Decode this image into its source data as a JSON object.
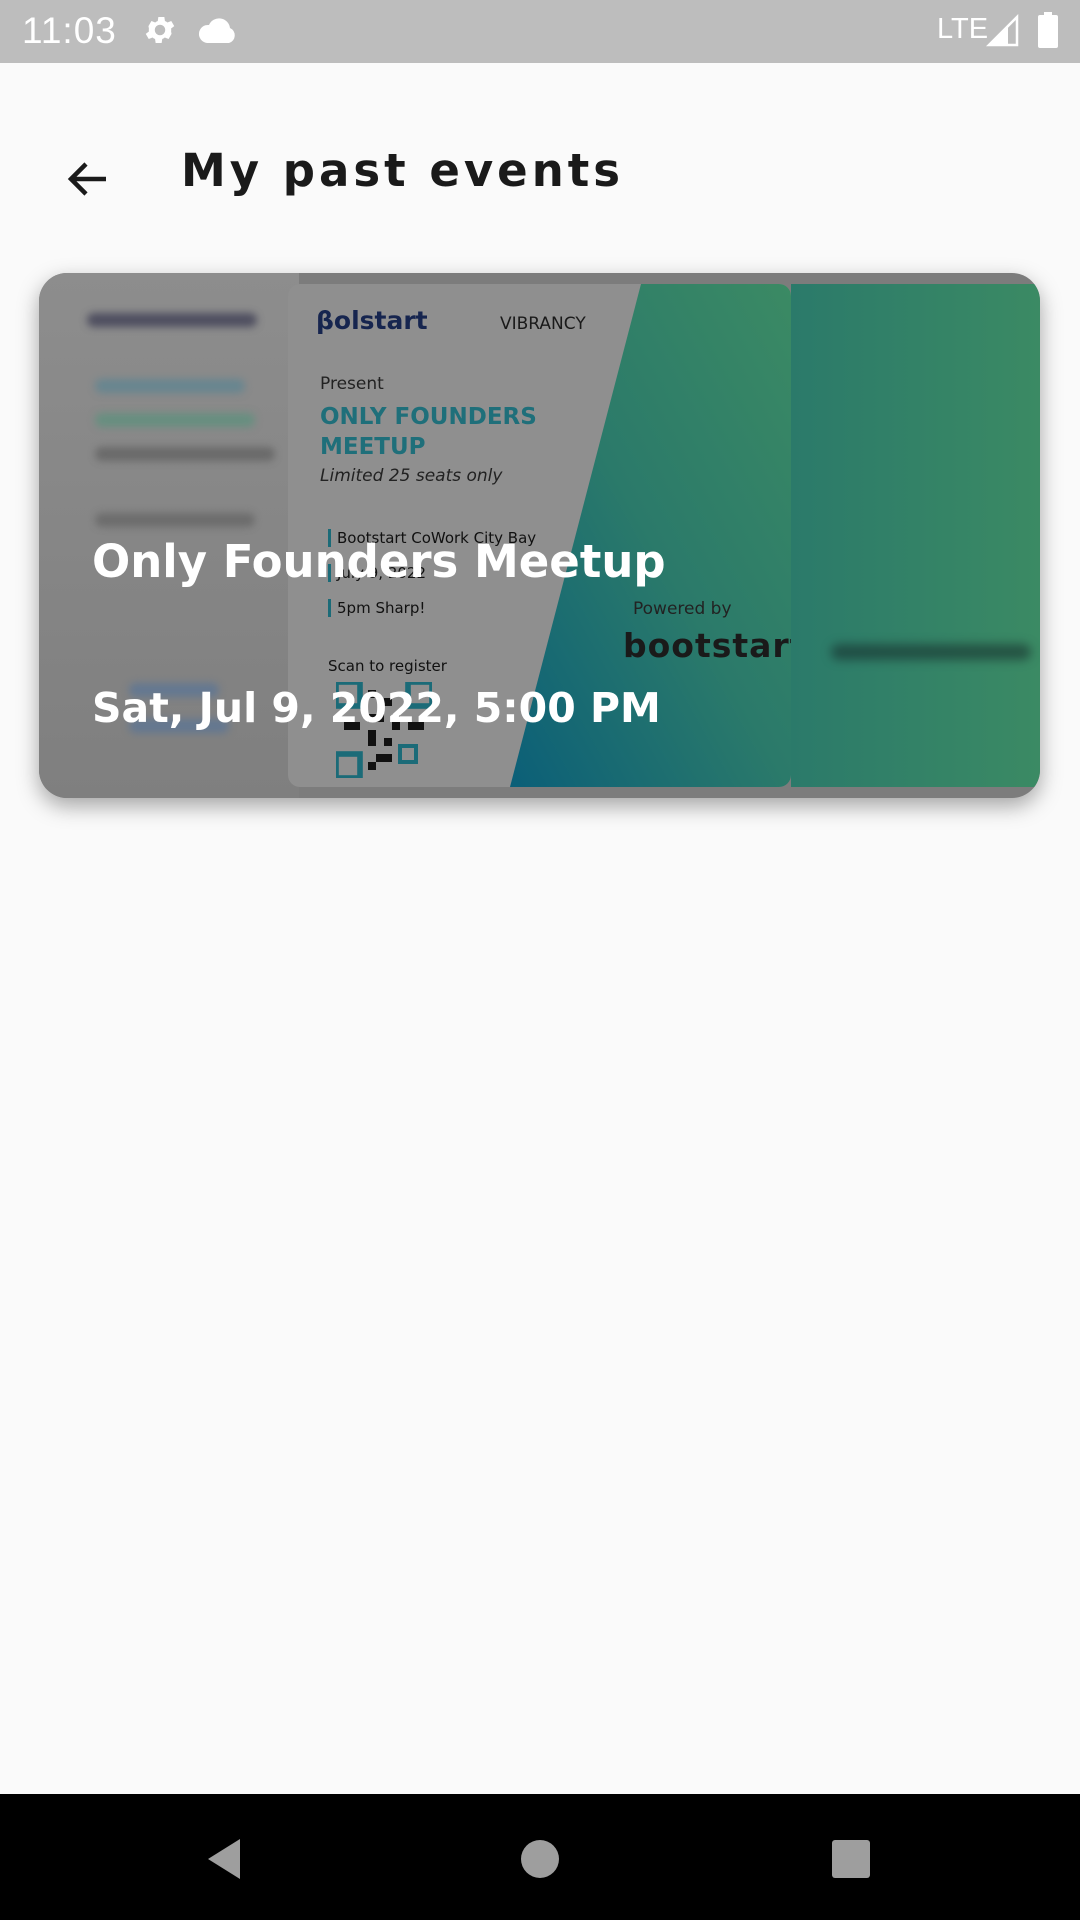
{
  "status_bar": {
    "time": "11:03",
    "network": "LTE",
    "icons": [
      "settings-icon",
      "cloud-icon",
      "signal-icon",
      "battery-icon"
    ]
  },
  "app_bar": {
    "back_icon": "arrow-left-icon",
    "title": "My past events"
  },
  "events": [
    {
      "title": "Only Founders Meetup",
      "datetime": "Sat, Jul 9, 2022, 5:00 PM",
      "poster": {
        "brand_left": "βolstart",
        "brand_right": "VIBRANCY",
        "present": "Present",
        "headline_line1": "ONLY FOUNDERS",
        "headline_line2": "MEETUP",
        "seats": "Limited 25 seats only",
        "venue": "Bootstart CoWork City Bay",
        "date_short": "July 9, 2022",
        "time_short": "5pm Sharp!",
        "scan": "Scan to register",
        "powered_by": "Powered by",
        "powered_brand": "bootstart"
      }
    }
  ],
  "colors": {
    "status_bar_bg": "#bdbdbd",
    "page_bg": "#fafafa",
    "poster_teal": "#1f6f7a",
    "poster_green": "#3b8a64",
    "nav_bar_bg": "#000000"
  },
  "nav_bar": {
    "buttons": [
      "back-triangle-icon",
      "home-circle-icon",
      "recents-square-icon"
    ]
  }
}
